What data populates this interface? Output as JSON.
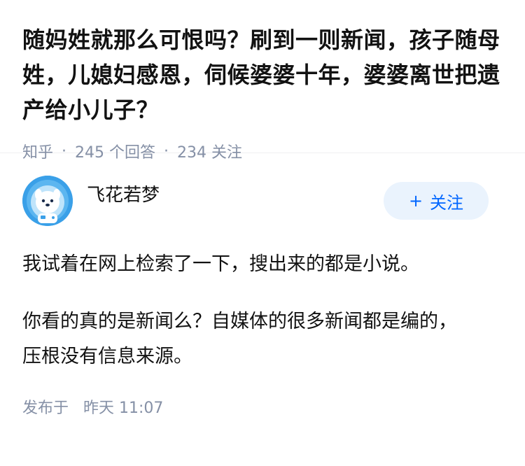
{
  "question": {
    "title": "随妈姓就那么可恨吗？刷到一则新闻，孩子随母姓，儿媳妇感恩，伺候婆婆十年，婆婆离世把遗产给小儿子？",
    "source": "知乎",
    "answers": "245 个回答",
    "follows": "234 关注"
  },
  "author": {
    "name": "飞花若梦",
    "avatar_icon": "cartoon-dog-avatar",
    "follow_label": "关注",
    "follow_icon": "plus"
  },
  "answer": {
    "paragraphs": [
      "我试着在网上检索了一下，搜出来的都是小说。",
      "你看的真的是新闻么？自媒体的很多新闻都是编的，压根没有信息来源。"
    ],
    "posted_label": "发布于",
    "posted_time": "昨天 11:07"
  },
  "colors": {
    "meta_gray": "#8590a6",
    "accent_blue": "#0066ff",
    "follow_bg": "#eaf3fd",
    "avatar_bg": "#3aa0e8"
  }
}
